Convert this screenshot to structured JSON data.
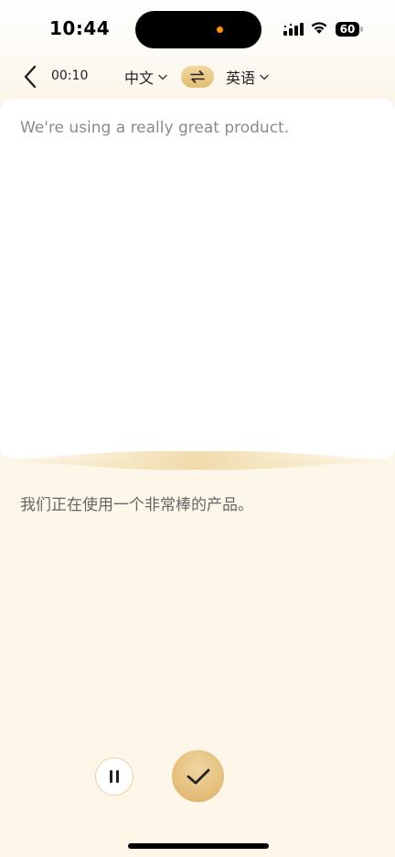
{
  "status_bar": {
    "time": "10:44",
    "battery": "60",
    "recording_dot_color": "#ff9500"
  },
  "nav": {
    "back_icon": "chevron-left-icon",
    "timer": "00:10",
    "source_language": "中文",
    "target_language": "英语",
    "swap_icon": "swap-arrows-icon",
    "dropdown_icon": "chevron-down-icon"
  },
  "source": {
    "text": "We're using a really great product."
  },
  "translation": {
    "text": "我们正在使用一个非常棒的产品。"
  },
  "controls": {
    "pause_icon": "pause-icon",
    "confirm_icon": "check-icon"
  },
  "colors": {
    "accent": "#e2bd73",
    "background": "#fdf6e8"
  }
}
